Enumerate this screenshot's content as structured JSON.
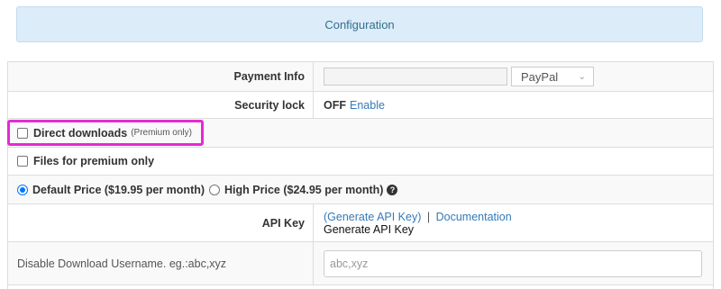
{
  "banner": {
    "title": "Configuration"
  },
  "rows": {
    "payment": {
      "label": "Payment Info",
      "input_value": "",
      "select_value": "PayPal"
    },
    "security": {
      "label": "Security lock",
      "status": "OFF",
      "action": "Enable"
    },
    "direct_downloads": {
      "label": "Direct downloads",
      "note": "(Premium only)",
      "checked": false
    },
    "premium_files": {
      "label": "Files for premium only",
      "checked": false
    },
    "pricing": {
      "default_label": "Default Price ($19.95 per month)",
      "high_label": "High Price ($24.95 per month)",
      "selected": "default",
      "help_icon": "question-circle-icon"
    },
    "api": {
      "label": "API Key",
      "generate_link": "(Generate API Key)",
      "separator": "|",
      "docs_link": "Documentation",
      "sub_text": "Generate API Key"
    },
    "disable_download": {
      "label": "Disable Download Username. eg.:abc,xyz",
      "placeholder": "abc,xyz",
      "value": ""
    }
  },
  "colors": {
    "banner_bg": "#dcecf8",
    "link": "#337ab7",
    "highlight": "#e52ad3",
    "radio_accent": "#0075ff"
  }
}
